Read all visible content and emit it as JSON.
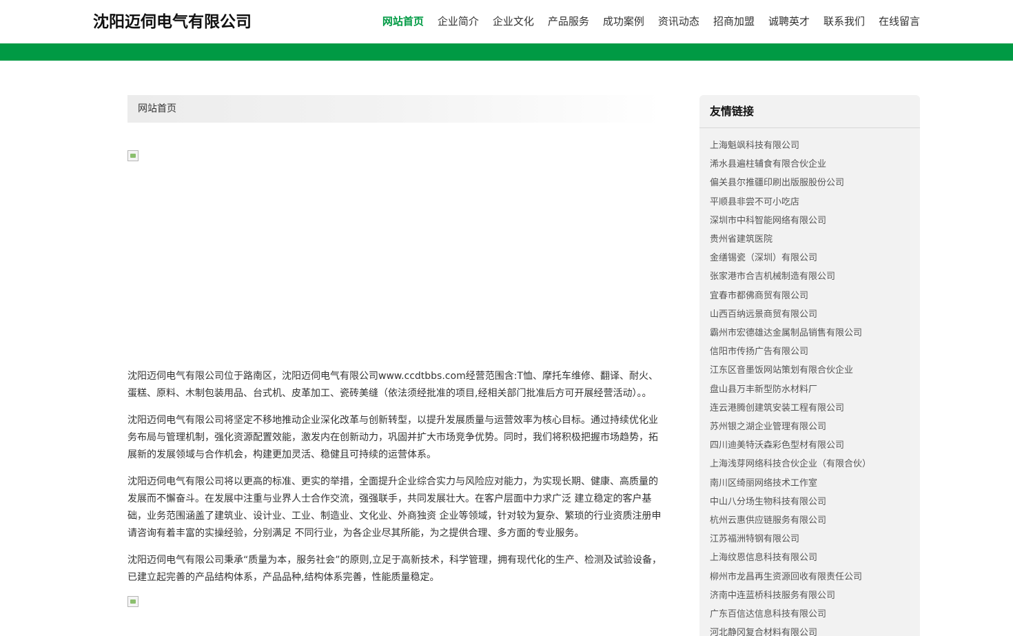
{
  "header": {
    "site_title": "沈阳迈伺电气有限公司",
    "nav": [
      {
        "label": "网站首页",
        "active": true
      },
      {
        "label": "企业简介"
      },
      {
        "label": "企业文化"
      },
      {
        "label": "产品服务"
      },
      {
        "label": "成功案例"
      },
      {
        "label": "资讯动态"
      },
      {
        "label": "招商加盟"
      },
      {
        "label": "诚聘英才"
      },
      {
        "label": "联系我们"
      },
      {
        "label": "在线留言"
      }
    ]
  },
  "colors": {
    "accent": "#009a44",
    "sidebar_bg": "#f2f2f2"
  },
  "main": {
    "breadcrumb": "网站首页",
    "paragraphs": [
      "沈阳迈伺电气有限公司位于路南区，沈阳迈伺电气有限公司www.ccdtbbs.com经营范围含:T恤、摩托车维修、翻译、耐火、蛋糕、原料、木制包装用品、台式机、皮革加工、瓷砖美缝（依法须经批准的项目,经相关部门批准后方可开展经营活动）。。",
      "沈阳迈伺电气有限公司将坚定不移地推动企业深化改革与创新转型，以提升发展质量与运营效率为核心目标。通过持续优化业务布局与管理机制，强化资源配置效能，激发内在创新动力，巩固并扩大市场竞争优势。同时，我们将积极把握市场趋势，拓展新的发展领域与合作机会，构建更加灵活、稳健且可持续的运营体系。",
      "沈阳迈伺电气有限公司将以更高的标准、更实的举措，全面提升企业综合实力与风险应对能力，为实现长期、健康、高质量的发展而不懈奋斗。在发展中注重与业界人士合作交流，强强联手，共同发展壮大。在客户层面中力求广泛 建立稳定的客户基础，业务范围涵盖了建筑业、设计业、工业、制造业、文化业、外商独资 企业等领域，针对较为复杂、繁琐的行业资质注册申请咨询有着丰富的实操经验，分别满足 不同行业，为各企业尽其所能，为之提供合理、多方面的专业服务。",
      "沈阳迈伺电气有限公司秉承“质量为本，服务社会”的原则,立足于高新技术，科学管理，拥有现代化的生产、检测及试验设备，已建立起完善的产品结构体系，产品品种,结构体系完善，性能质量稳定。"
    ]
  },
  "sidebar": {
    "title": "友情链接",
    "links": [
      "上海魁飒科技有限公司",
      "浠水县遍柱辅食有限合伙企业",
      "偏关县尔推疆印刷出版服股份公司",
      "平顺县非尝不可小吃店",
      "深圳市中科智能网络有限公司",
      "贵州省建筑医院",
      "金缮锡瓷（深圳）有限公司",
      "张家港市合吉机械制造有限公司",
      "宜春市都佛商贸有限公司",
      "山西百纳远景商贸有限公司",
      "霸州市宏德雄达金属制品销售有限公司",
      "信阳市传扬广告有限公司",
      "江东区音墨饭网站策划有限合伙企业",
      "盘山县万丰新型防水材料厂",
      "连云港腾创建筑安装工程有限公司",
      "苏州银之湖企业管理有限公司",
      "四川迪美特沃森彩色型材有限公司",
      "上海浅芽网络科技合伙企业（有限合伙）",
      "南川区绮丽网络技术工作室",
      "中山八分场生物科技有限公司",
      "杭州云惠供应链服务有限公司",
      "江苏福洲特钢有限公司",
      "上海纹恩信息科技有限公司",
      "柳州市龙昌再生资源回收有限责任公司",
      "济南中连蓝桥科技服务有限公司",
      "广东百信达信息科技有限公司",
      "河北静冈复合材料有限公司"
    ]
  }
}
